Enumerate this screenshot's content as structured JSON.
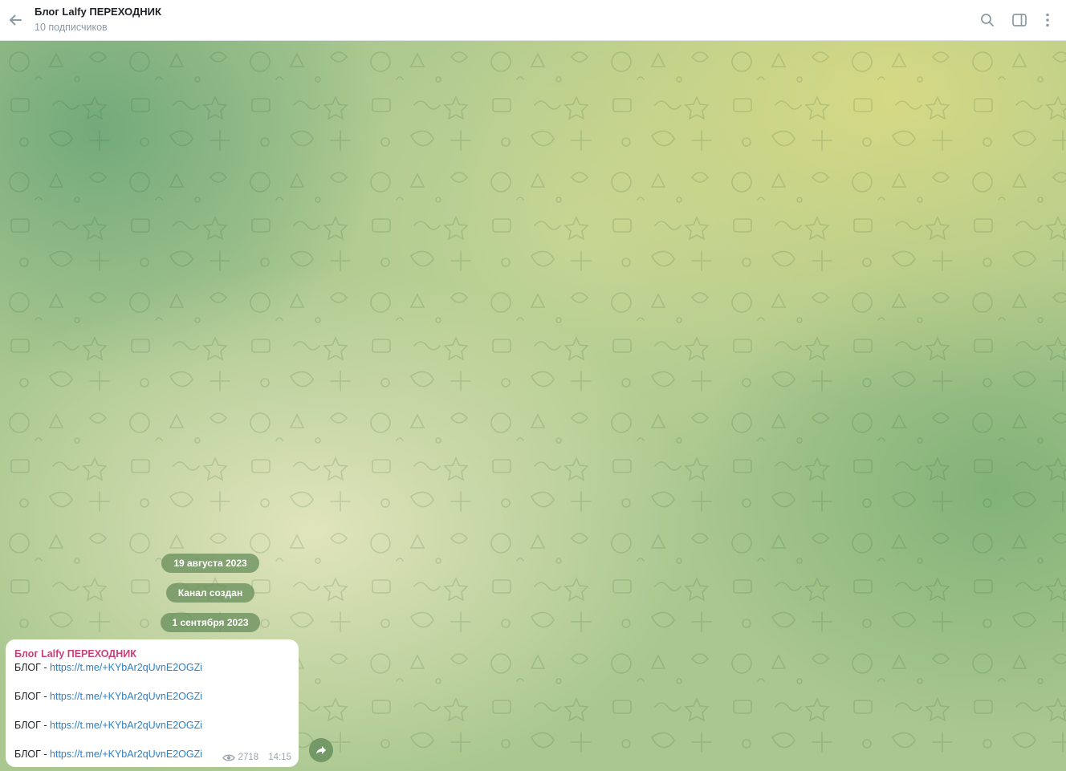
{
  "header": {
    "title": "Блог Lalfy ПЕРЕХОДНИК",
    "subtitle": "10 подписчиков",
    "icons": [
      "back-arrow-icon",
      "search-icon",
      "sidebar-toggle-icon",
      "more-vertical-icon"
    ]
  },
  "chat": {
    "date_pills": [
      "19 августа 2023",
      "Канал создан",
      "1 сентября 2023"
    ],
    "message": {
      "author": "Блог Lalfy ПЕРЕХОДНИК",
      "lines": [
        {
          "prefix": "БЛОГ - ",
          "link": "https://t.me/+KYbAr2qUvnE2OGZi"
        },
        {
          "prefix": "БЛОГ - ",
          "link": "https://t.me/+KYbAr2qUvnE2OGZi"
        },
        {
          "prefix": "БЛОГ - ",
          "link": "https://t.me/+KYbAr2qUvnE2OGZi"
        },
        {
          "prefix": "БЛОГ - ",
          "link": "https://t.me/+KYbAr2qUvnE2OGZi"
        }
      ],
      "views": "2718",
      "time": "14:15"
    },
    "share_icon": "share-arrow-icon"
  },
  "colors": {
    "author": "#c8417a",
    "link": "#2b80c7",
    "pill_bg": "#628a58",
    "header_subtitle": "#8a9aa6"
  }
}
